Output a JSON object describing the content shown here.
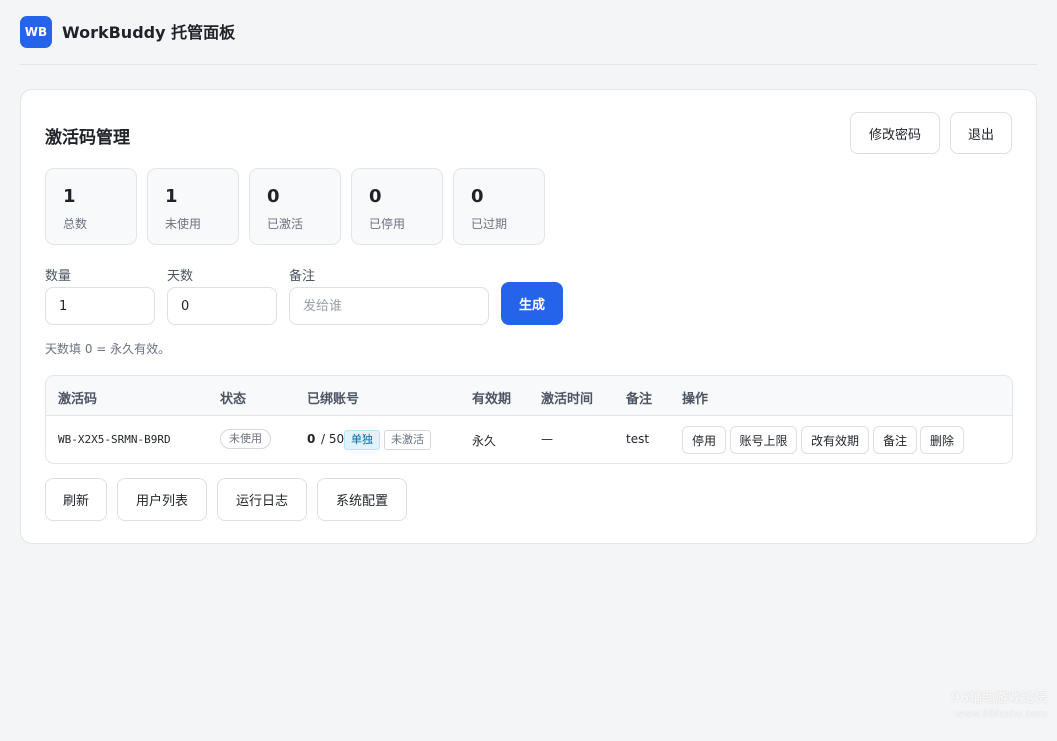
{
  "app": {
    "logo_text": "WB",
    "title": "WorkBuddy 托管面板"
  },
  "header": {
    "title": "激活码管理",
    "change_password_label": "修改密码",
    "logout_label": "退出"
  },
  "stats": [
    {
      "value": "1",
      "label": "总数"
    },
    {
      "value": "1",
      "label": "未使用"
    },
    {
      "value": "0",
      "label": "已激活"
    },
    {
      "value": "0",
      "label": "已停用"
    },
    {
      "value": "0",
      "label": "已过期"
    }
  ],
  "form": {
    "quantity_label": "数量",
    "quantity_value": "1",
    "days_label": "天数",
    "days_value": "0",
    "note_label": "备注",
    "note_placeholder": "发给谁",
    "generate_label": "生成",
    "hint": "天数填 0 = 永久有效。"
  },
  "table": {
    "headers": [
      "激活码",
      "状态",
      "已绑账号",
      "有效期",
      "激活时间",
      "备注",
      "操作"
    ],
    "rows": [
      {
        "code": "WB-X2X5-SRMN-B9RD",
        "status": "未使用",
        "bound_count": "0",
        "bound_separator": "/ 50",
        "mode_tag": "单独",
        "activation_tag": "未激活",
        "validity": "永久",
        "activated_at": "—",
        "note": "test",
        "actions": [
          "停用",
          "账号上限",
          "改有效期",
          "备注",
          "删除"
        ]
      }
    ]
  },
  "footer_buttons": [
    "刷新",
    "用户列表",
    "运行日志",
    "系统配置"
  ],
  "watermark": {
    "line1": "96辅助游戏论坛",
    "line2": "www.96fuzhu.com"
  },
  "colors": {
    "accent": "#2563eb",
    "background": "#f4f5f7"
  }
}
